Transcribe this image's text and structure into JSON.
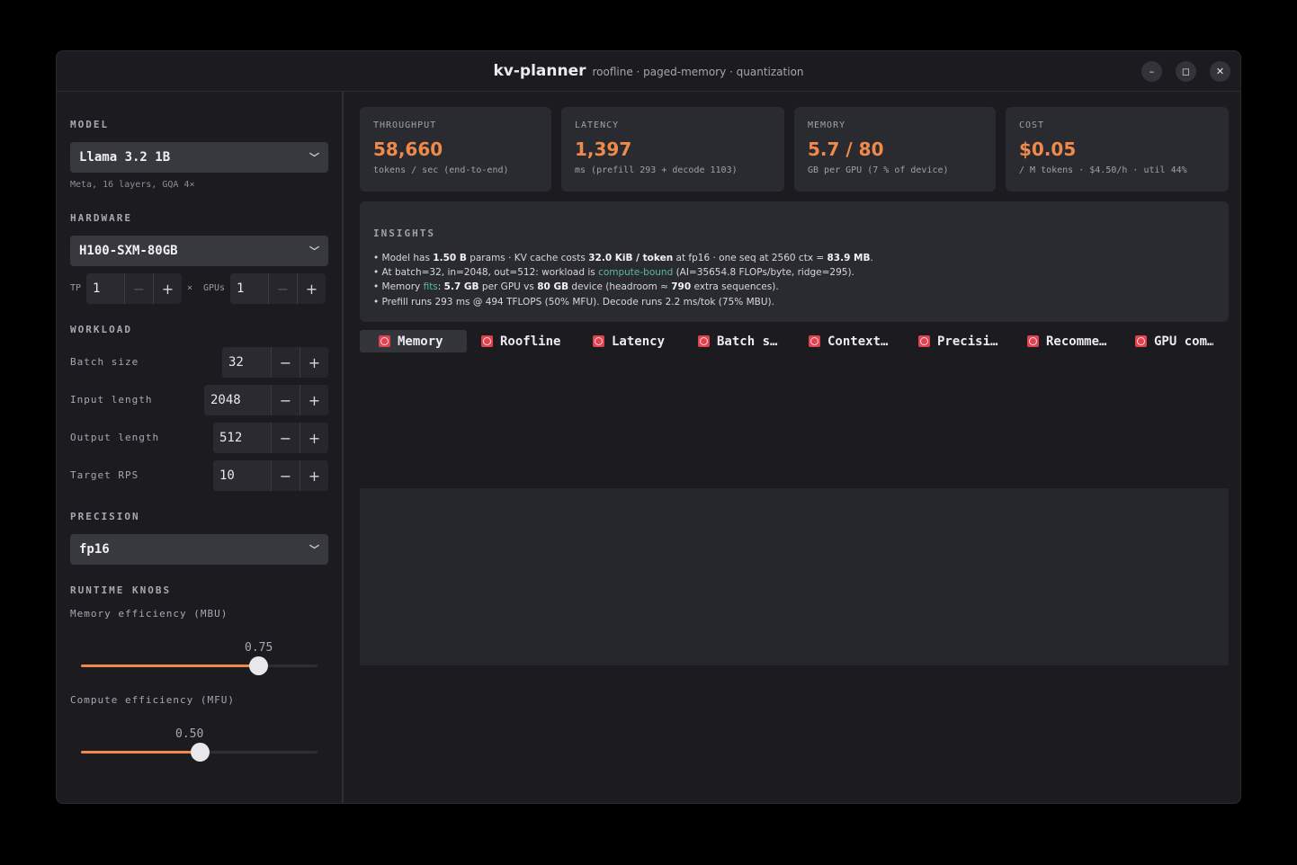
{
  "window": {
    "title": "kv-planner",
    "subtitle": "roofline · paged-memory · quantization",
    "controls": {
      "minimize": "–",
      "maximize": "◻",
      "close": "✕"
    }
  },
  "sidebar": {
    "model": {
      "label": "MODEL",
      "selected": "Llama 3.2 1B",
      "hint": "Meta, 16 layers, GQA 4×"
    },
    "hardware": {
      "label": "HARDWARE",
      "selected": "H100-SXM-80GB",
      "tp_label": "TP",
      "tp_value": "1",
      "times": "×",
      "gpus_label": "GPUs",
      "gpus_value": "1"
    },
    "workload": {
      "label": "WORKLOAD",
      "rows": [
        {
          "label": "Batch size",
          "value": "32"
        },
        {
          "label": "Input length",
          "value": "2048"
        },
        {
          "label": "Output length",
          "value": "512"
        },
        {
          "label": "Target RPS",
          "value": "10"
        }
      ]
    },
    "precision": {
      "label": "PRECISION",
      "selected": "fp16"
    },
    "runtime": {
      "label": "RUNTIME KNOBS",
      "mbu": {
        "label": "Memory efficiency (MBU)",
        "value_text": "0.75",
        "value": 0.75
      },
      "mfu": {
        "label": "Compute efficiency (MFU)",
        "value_text": "0.50",
        "value": 0.5
      }
    },
    "minus": "−",
    "plus": "+"
  },
  "cards": [
    {
      "key": "THROUGHPUT",
      "value": "58,660",
      "sub": "tokens / sec (end-to-end)"
    },
    {
      "key": "LATENCY",
      "value": "1,397",
      "sub": "ms  (prefill 293 + decode 1103)"
    },
    {
      "key": "MEMORY",
      "value": "5.7 / 80",
      "sub": "GB per GPU  (7 % of device)"
    },
    {
      "key": "COST",
      "value": "$0.05",
      "sub": "/ M tokens · $4.50/h · util 44%"
    }
  ],
  "insights": {
    "label": "INSIGHTS",
    "l1": [
      "• Model has ",
      "1.50 B",
      " params · KV cache costs ",
      "32.0 KiB / token",
      " at fp16 · one seq at 2560 ctx = ",
      "83.9 MB",
      "."
    ],
    "l2": [
      "• At batch=32, in=2048, out=512: workload is ",
      "compute-bound",
      " (AI=35654.8 FLOPs/byte, ridge=295)."
    ],
    "l3": [
      "• Memory ",
      "fits",
      ": ",
      "5.7 GB",
      " per GPU vs ",
      "80 GB",
      " device (headroom ≈ ",
      "790",
      " extra sequences)."
    ],
    "l4": "• Prefill runs 293 ms @ 494 TFLOPS (50% MFU). Decode runs 2.2 ms/tok (75% MBU)."
  },
  "tabs": [
    "Memory",
    "Roofline",
    "Latency",
    "Batch s…",
    "Context…",
    "Precisi…",
    "Recomme…",
    "GPU com…"
  ],
  "colors": {
    "accent": "#f08a4b",
    "good": "#5cb8a3",
    "tab_icon": "#e0424f"
  }
}
